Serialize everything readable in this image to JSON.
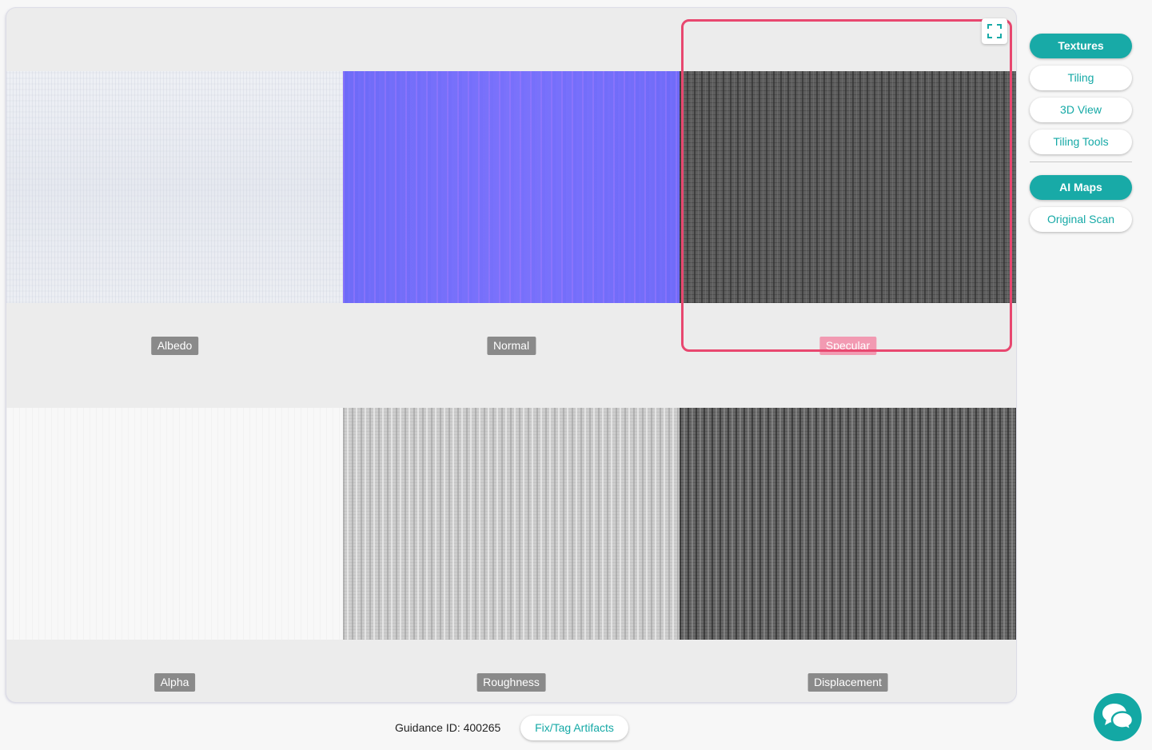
{
  "maps": [
    {
      "label": "Albedo",
      "selected": false
    },
    {
      "label": "Normal",
      "selected": false
    },
    {
      "label": "Specular",
      "selected": true
    },
    {
      "label": "Alpha",
      "selected": false
    },
    {
      "label": "Roughness",
      "selected": false
    },
    {
      "label": "Displacement",
      "selected": false
    }
  ],
  "sidebar": {
    "view_buttons": [
      {
        "label": "Textures",
        "active": true
      },
      {
        "label": "Tiling",
        "active": false
      },
      {
        "label": "3D View",
        "active": false
      },
      {
        "label": "Tiling Tools",
        "active": false
      }
    ],
    "source_buttons": [
      {
        "label": "AI Maps",
        "active": true
      },
      {
        "label": "Original Scan",
        "active": false
      }
    ]
  },
  "footer": {
    "guidance": "Guidance ID: 400265",
    "fix_button": "Fix/Tag Artifacts"
  },
  "icons": {
    "expand": "expand-icon",
    "chat": "chat-icon"
  },
  "colors": {
    "accent": "#18aaa7",
    "selection": "#e8476f",
    "selected_label": "#f29ab2"
  }
}
